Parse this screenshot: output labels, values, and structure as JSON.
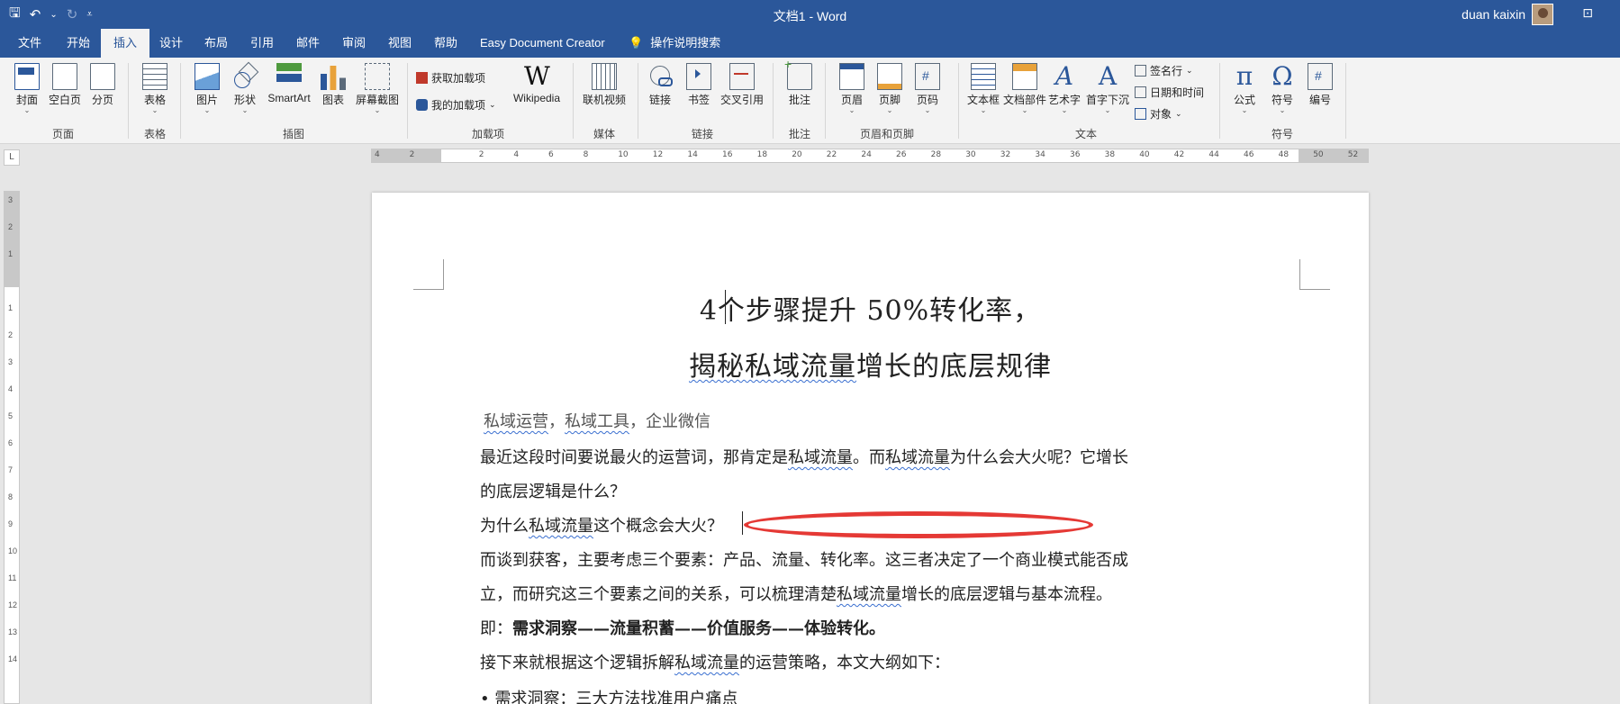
{
  "titlebar": {
    "title": "文档1  -  Word",
    "user": "duan kaixin",
    "qat": {
      "save": "🖫",
      "undo": "↶",
      "undo_dd": "⌄",
      "redo": "↻",
      "customize": "⩡"
    },
    "window_control": "⊡"
  },
  "menu": {
    "tabs": [
      "文件",
      "开始",
      "插入",
      "设计",
      "布局",
      "引用",
      "邮件",
      "审阅",
      "视图",
      "帮助",
      "Easy Document Creator"
    ],
    "active_tab": "插入",
    "tell_me": "操作说明搜索"
  },
  "ribbon": {
    "pages": {
      "group": "页面",
      "cover": "封面",
      "blank": "空白页",
      "break": "分页"
    },
    "tables": {
      "group": "表格",
      "table": "表格"
    },
    "illustrations": {
      "group": "插图",
      "pictures": "图片",
      "shapes": "形状",
      "smartart": "SmartArt",
      "chart": "图表",
      "screenshot": "屏幕截图"
    },
    "addins": {
      "group": "加载项",
      "get": "获取加载项",
      "my": "我的加载项",
      "wikipedia": "Wikipedia",
      "wiki_glyph": "W"
    },
    "media": {
      "group": "媒体",
      "online_video": "联机视频"
    },
    "links": {
      "group": "链接",
      "link": "链接",
      "bookmark": "书签",
      "crossref": "交叉引用"
    },
    "comments": {
      "group": "批注",
      "comment": "批注"
    },
    "header_footer": {
      "group": "页眉和页脚",
      "header": "页眉",
      "footer": "页脚",
      "page_number": "页码"
    },
    "text": {
      "group": "文本",
      "textbox": "文本框",
      "quick_parts": "文档部件",
      "wordart": "艺术字",
      "dropcap": "首字下沉",
      "signature": "签名行",
      "datetime": "日期和时间",
      "object": "对象"
    },
    "symbols": {
      "group": "符号",
      "equation": "公式",
      "symbol": "符号",
      "number": "编号",
      "pi": "π",
      "omega": "Ω",
      "wordart_glyph": "A"
    }
  },
  "ruler": {
    "corner": "L",
    "ticks": [
      "4",
      "2",
      "",
      "2",
      "4",
      "6",
      "8",
      "10",
      "12",
      "14",
      "16",
      "18",
      "20",
      "22",
      "24",
      "26",
      "28",
      "30",
      "32",
      "34",
      "36",
      "38",
      "40",
      "42",
      "44",
      "46",
      "48",
      "50",
      "52"
    ],
    "vticks": [
      "3",
      "2",
      "1",
      "",
      "1",
      "2",
      "3",
      "4",
      "5",
      "6",
      "7",
      "8",
      "9",
      "10",
      "11",
      "12",
      "13",
      "14"
    ]
  },
  "document": {
    "title_line1": "4个步骤提升 50%转化率，",
    "title_line2_a": "揭秘私域流量",
    "title_line2_b": "增长的底层规律",
    "keywords": [
      {
        "text": "私域运营",
        "squig": true
      },
      {
        "text": "，",
        "squig": false
      },
      {
        "text": "私域工具",
        "squig": true
      },
      {
        "text": "，企业微信",
        "squig": false
      }
    ],
    "para1_a": "最近这段时间要说最火的运营词，那肯定是",
    "para1_b": "私域流量",
    "para1_c": "。而",
    "para1_d": "私域流量",
    "para1_e": "为什么会大火呢？它增长",
    "para1_line2": "的底层逻辑是什么？",
    "para2_a": "为什么",
    "para2_b": "私域流量",
    "para2_c": "这个概念会大火？",
    "para3_line1": "而谈到获客，主要考虑三个要素：产品、流量、转化率。这三者决定了一个商业模式能否成",
    "para3_line2_a": "立，而研究这三个要素之间的关系，可以梳理清楚",
    "para3_line2_b": "私域流量",
    "para3_line2_c": "增长的底层逻辑与基本流程。",
    "para4_a": "即：",
    "para4_b": "需求洞察——流量积蓄——价值服务——体验转化。",
    "para5_a": "接下来就根据这个逻辑拆解",
    "para5_b": "私域流量",
    "para5_c": "的运营策略，本文大纲如下：",
    "bullet1": "• 需求洞察：三大方法找准用户痛点"
  },
  "colors": {
    "brand": "#2b579a",
    "ribbon_bg": "#f3f3f3",
    "annotation": "#e53935"
  }
}
